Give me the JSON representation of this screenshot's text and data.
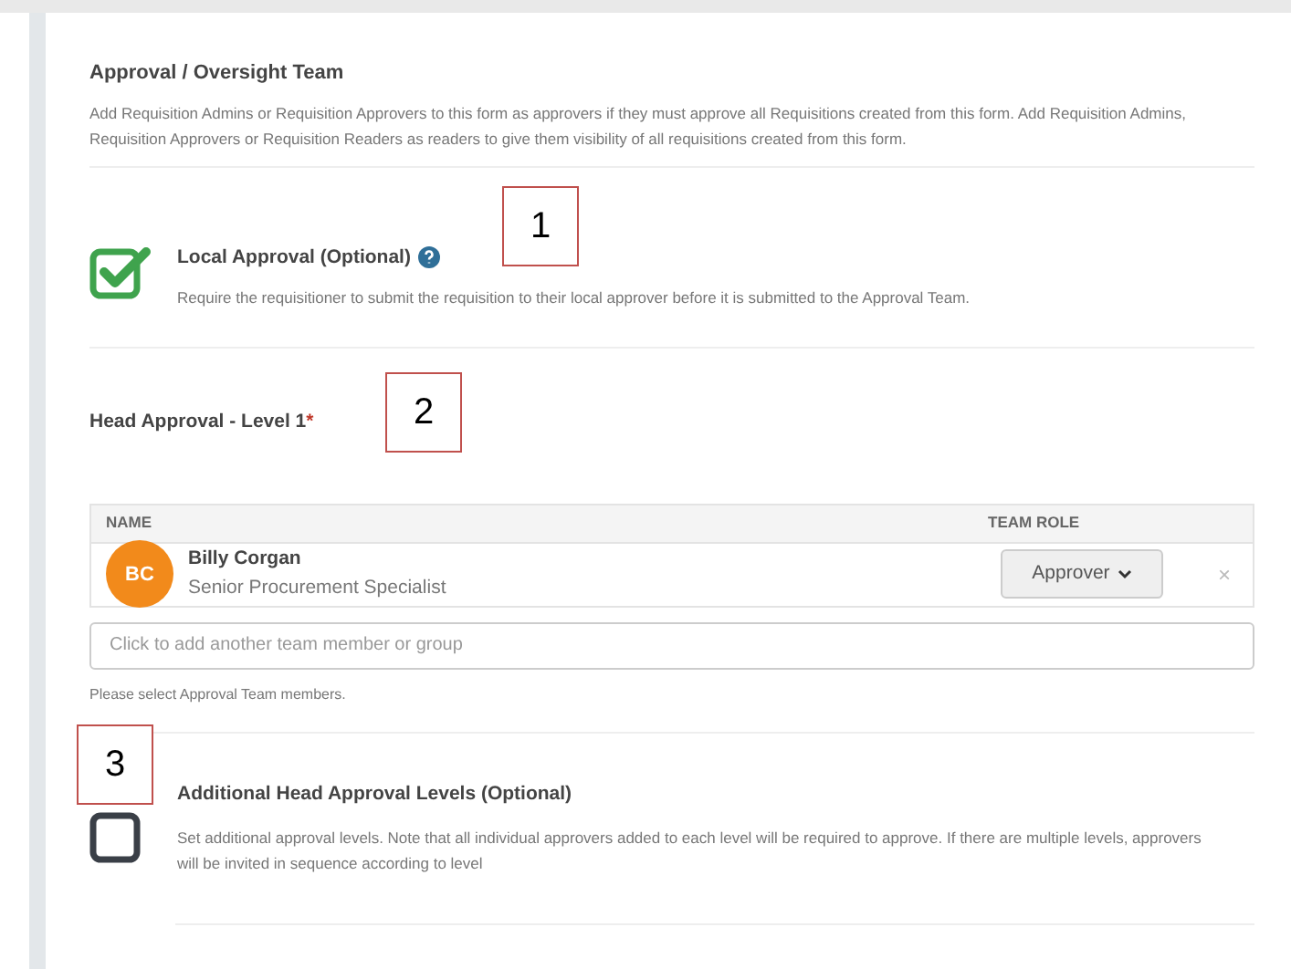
{
  "section": {
    "title": "Approval / Oversight Team",
    "description": "Add Requisition Admins or Requisition Approvers to this form as approvers if they must approve all Requisitions created from this form. Add Requisition Admins, Requisition Approvers or Requisition Readers as readers to give them visibility of all requisitions created from this form."
  },
  "local_approval": {
    "title": "Local Approval (Optional)",
    "description": "Require the requisitioner to submit the requisition to their local approver before it is submitted to the Approval Team.",
    "checked": true
  },
  "head_approval": {
    "title": "Head Approval - Level 1",
    "required_mark": "*",
    "columns": [
      "NAME",
      "TEAM ROLE"
    ],
    "members": [
      {
        "initials": "BC",
        "name": "Billy Corgan",
        "title": "Senior Procurement Specialist",
        "role": "Approver",
        "remove": "×"
      }
    ],
    "add_placeholder": "Click to add another team member or group",
    "hint": "Please select Approval Team members."
  },
  "additional_levels": {
    "title": "Additional Head Approval Levels (Optional)",
    "description": "Set additional approval levels. Note that all individual approvers added to each level will be required to approve. If there are multiple levels, approvers will be invited in sequence according to level",
    "checked": false
  },
  "callouts": [
    "1",
    "2",
    "3"
  ]
}
